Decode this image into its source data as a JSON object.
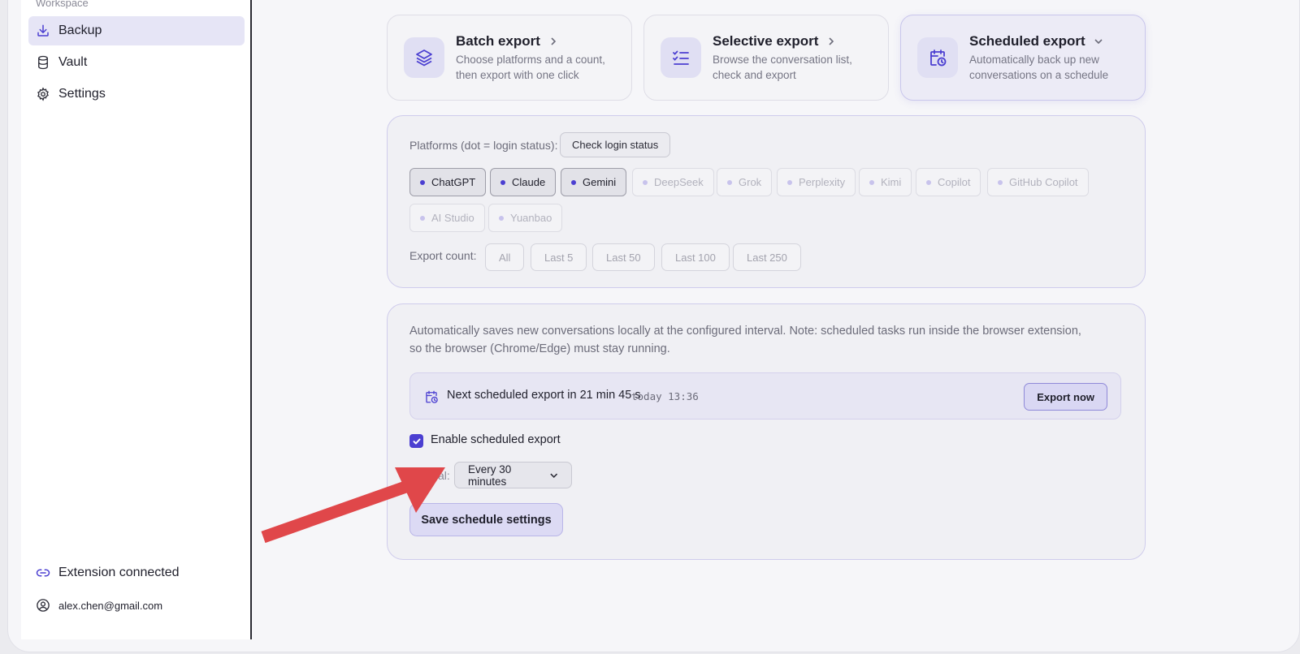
{
  "sidebar": {
    "section_label": "Workspace",
    "items": [
      {
        "label": "Backup",
        "icon": "download-tray-icon",
        "active": true
      },
      {
        "label": "Vault",
        "icon": "database-icon",
        "active": false
      },
      {
        "label": "Settings",
        "icon": "gear-icon",
        "active": false
      }
    ],
    "connection_status": "Extension connected",
    "account_email": "alex.chen@gmail.com"
  },
  "modes": [
    {
      "title": "Batch export",
      "desc": "Choose platforms and a count, then export with one click",
      "icon": "layers-icon",
      "chevron": "chevron-right-icon",
      "active": false
    },
    {
      "title": "Selective export",
      "desc": "Browse the conversation list, check and export",
      "icon": "checklist-icon",
      "chevron": "chevron-right-icon",
      "active": false
    },
    {
      "title": "Scheduled export",
      "desc": "Automatically back up new conversations on a schedule",
      "icon": "calendar-clock-icon",
      "chevron": "chevron-down-icon",
      "active": true
    }
  ],
  "platforms": {
    "label": "Platforms (dot = login status):",
    "check_button": "Check login status",
    "items": [
      {
        "name": "ChatGPT",
        "selected": true
      },
      {
        "name": "Claude",
        "selected": true
      },
      {
        "name": "Gemini",
        "selected": true
      },
      {
        "name": "DeepSeek",
        "selected": false
      },
      {
        "name": "Grok",
        "selected": false
      },
      {
        "name": "Perplexity",
        "selected": false
      },
      {
        "name": "Kimi",
        "selected": false
      },
      {
        "name": "Copilot",
        "selected": false
      },
      {
        "name": "GitHub Copilot",
        "selected": false
      },
      {
        "name": "AI Studio",
        "selected": false
      },
      {
        "name": "Yuanbao",
        "selected": false
      }
    ]
  },
  "export_count": {
    "label": "Export count:",
    "options": [
      "All",
      "Last 5",
      "Last 50",
      "Last 100",
      "Last 250"
    ]
  },
  "schedule": {
    "note": "Automatically saves new conversations locally at the configured interval. Note: scheduled tasks run inside the browser extension, so the browser (Chrome/Edge) must stay running.",
    "next_text": "Next scheduled export in 21 min 45 s",
    "next_time": "today 13:36",
    "export_now": "Export now",
    "enable_label": "Enable scheduled export",
    "enabled": true,
    "interval_label": "Interval:",
    "interval_value": "Every 30 minutes",
    "save_label": "Save schedule settings"
  },
  "colors": {
    "accent": "#4b3fd1",
    "accent_soft": "#e0dff3",
    "annotation_arrow": "#e0474a"
  }
}
